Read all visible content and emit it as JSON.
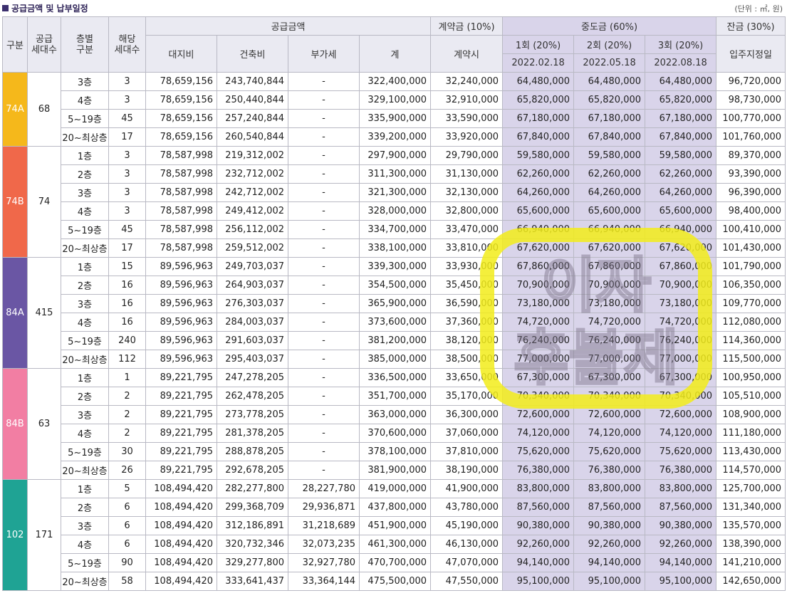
{
  "title": "공급금액 및 납부일정",
  "unit": "(단위 : ㎡, 원)",
  "header": {
    "col_type": "구분",
    "col_supply_units": "공급\n세대수",
    "col_floor": "층별\n구분",
    "col_units": "해당\n세대수",
    "supply_group": "공급금액",
    "land": "대지비",
    "building": "건축비",
    "vat": "부가세",
    "total": "계",
    "contract_group": "계약금 (10%)",
    "contract_sub": "계약시",
    "middle_group": "중도금 (60%)",
    "mid1": "1회 (20%)",
    "mid2": "2회 (20%)",
    "mid3": "3회 (20%)",
    "mid1_date": "2022.02.18",
    "mid2_date": "2022.05.18",
    "mid3_date": "2022.08.18",
    "balance_group": "잔금 (30%)",
    "balance_sub": "입주지정일"
  },
  "watermark": "이자\n후불제",
  "groups": [
    {
      "type": "74A",
      "color": "#f5b81b",
      "supply_units": "68",
      "rows": [
        {
          "floor": "3층",
          "units": "3",
          "land": "78,659,156",
          "building": "243,740,844",
          "vat": "-",
          "total": "322,400,000",
          "contract": "32,240,000",
          "m1": "64,480,000",
          "m2": "64,480,000",
          "m3": "64,480,000",
          "balance": "96,720,000"
        },
        {
          "floor": "4층",
          "units": "3",
          "land": "78,659,156",
          "building": "250,440,844",
          "vat": "-",
          "total": "329,100,000",
          "contract": "32,910,000",
          "m1": "65,820,000",
          "m2": "65,820,000",
          "m3": "65,820,000",
          "balance": "98,730,000"
        },
        {
          "floor": "5~19층",
          "units": "45",
          "land": "78,659,156",
          "building": "257,240,844",
          "vat": "-",
          "total": "335,900,000",
          "contract": "33,590,000",
          "m1": "67,180,000",
          "m2": "67,180,000",
          "m3": "67,180,000",
          "balance": "100,770,000"
        },
        {
          "floor": "20~최상층",
          "units": "17",
          "land": "78,659,156",
          "building": "260,540,844",
          "vat": "-",
          "total": "339,200,000",
          "contract": "33,920,000",
          "m1": "67,840,000",
          "m2": "67,840,000",
          "m3": "67,840,000",
          "balance": "101,760,000"
        }
      ]
    },
    {
      "type": "74B",
      "color": "#f0684a",
      "supply_units": "74",
      "rows": [
        {
          "floor": "1층",
          "units": "3",
          "land": "78,587,998",
          "building": "219,312,002",
          "vat": "-",
          "total": "297,900,000",
          "contract": "29,790,000",
          "m1": "59,580,000",
          "m2": "59,580,000",
          "m3": "59,580,000",
          "balance": "89,370,000"
        },
        {
          "floor": "2층",
          "units": "3",
          "land": "78,587,998",
          "building": "232,712,002",
          "vat": "-",
          "total": "311,300,000",
          "contract": "31,130,000",
          "m1": "62,260,000",
          "m2": "62,260,000",
          "m3": "62,260,000",
          "balance": "93,390,000"
        },
        {
          "floor": "3층",
          "units": "3",
          "land": "78,587,998",
          "building": "242,712,002",
          "vat": "-",
          "total": "321,300,000",
          "contract": "32,130,000",
          "m1": "64,260,000",
          "m2": "64,260,000",
          "m3": "64,260,000",
          "balance": "96,390,000"
        },
        {
          "floor": "4층",
          "units": "3",
          "land": "78,587,998",
          "building": "249,412,002",
          "vat": "-",
          "total": "328,000,000",
          "contract": "32,800,000",
          "m1": "65,600,000",
          "m2": "65,600,000",
          "m3": "65,600,000",
          "balance": "98,400,000"
        },
        {
          "floor": "5~19층",
          "units": "45",
          "land": "78,587,998",
          "building": "256,112,002",
          "vat": "-",
          "total": "334,700,000",
          "contract": "33,470,000",
          "m1": "66,940,000",
          "m2": "66,940,000",
          "m3": "66,940,000",
          "balance": "100,410,000"
        },
        {
          "floor": "20~최상층",
          "units": "17",
          "land": "78,587,998",
          "building": "259,512,002",
          "vat": "-",
          "total": "338,100,000",
          "contract": "33,810,000",
          "m1": "67,620,000",
          "m2": "67,620,000",
          "m3": "67,620,000",
          "balance": "101,430,000"
        }
      ]
    },
    {
      "type": "84A",
      "color": "#6a56a4",
      "supply_units": "415",
      "rows": [
        {
          "floor": "1층",
          "units": "15",
          "land": "89,596,963",
          "building": "249,703,037",
          "vat": "-",
          "total": "339,300,000",
          "contract": "33,930,000",
          "m1": "67,860,000",
          "m2": "67,860,000",
          "m3": "67,860,000",
          "balance": "101,790,000"
        },
        {
          "floor": "2층",
          "units": "16",
          "land": "89,596,963",
          "building": "264,903,037",
          "vat": "-",
          "total": "354,500,000",
          "contract": "35,450,000",
          "m1": "70,900,000",
          "m2": "70,900,000",
          "m3": "70,900,000",
          "balance": "106,350,000"
        },
        {
          "floor": "3층",
          "units": "16",
          "land": "89,596,963",
          "building": "276,303,037",
          "vat": "-",
          "total": "365,900,000",
          "contract": "36,590,000",
          "m1": "73,180,000",
          "m2": "73,180,000",
          "m3": "73,180,000",
          "balance": "109,770,000"
        },
        {
          "floor": "4층",
          "units": "16",
          "land": "89,596,963",
          "building": "284,003,037",
          "vat": "-",
          "total": "373,600,000",
          "contract": "37,360,000",
          "m1": "74,720,000",
          "m2": "74,720,000",
          "m3": "74,720,000",
          "balance": "112,080,000"
        },
        {
          "floor": "5~19층",
          "units": "240",
          "land": "89,596,963",
          "building": "291,603,037",
          "vat": "-",
          "total": "381,200,000",
          "contract": "38,120,000",
          "m1": "76,240,000",
          "m2": "76,240,000",
          "m3": "76,240,000",
          "balance": "114,360,000"
        },
        {
          "floor": "20~최상층",
          "units": "112",
          "land": "89,596,963",
          "building": "295,403,037",
          "vat": "-",
          "total": "385,000,000",
          "contract": "38,500,000",
          "m1": "77,000,000",
          "m2": "77,000,000",
          "m3": "77,000,000",
          "balance": "115,500,000"
        }
      ]
    },
    {
      "type": "84B",
      "color": "#f27ea3",
      "supply_units": "63",
      "rows": [
        {
          "floor": "1층",
          "units": "1",
          "land": "89,221,795",
          "building": "247,278,205",
          "vat": "-",
          "total": "336,500,000",
          "contract": "33,650,000",
          "m1": "67,300,000",
          "m2": "67,300,000",
          "m3": "67,300,000",
          "balance": "100,950,000"
        },
        {
          "floor": "2층",
          "units": "2",
          "land": "89,221,795",
          "building": "262,478,205",
          "vat": "-",
          "total": "351,700,000",
          "contract": "35,170,000",
          "m1": "70,340,000",
          "m2": "70,340,000",
          "m3": "70,340,000",
          "balance": "105,510,000"
        },
        {
          "floor": "3층",
          "units": "2",
          "land": "89,221,795",
          "building": "273,778,205",
          "vat": "-",
          "total": "363,000,000",
          "contract": "36,300,000",
          "m1": "72,600,000",
          "m2": "72,600,000",
          "m3": "72,600,000",
          "balance": "108,900,000"
        },
        {
          "floor": "4층",
          "units": "2",
          "land": "89,221,795",
          "building": "281,378,205",
          "vat": "-",
          "total": "370,600,000",
          "contract": "37,060,000",
          "m1": "74,120,000",
          "m2": "74,120,000",
          "m3": "74,120,000",
          "balance": "111,180,000"
        },
        {
          "floor": "5~19층",
          "units": "30",
          "land": "89,221,795",
          "building": "288,878,205",
          "vat": "-",
          "total": "378,100,000",
          "contract": "37,810,000",
          "m1": "75,620,000",
          "m2": "75,620,000",
          "m3": "75,620,000",
          "balance": "113,430,000"
        },
        {
          "floor": "20~최상층",
          "units": "26",
          "land": "89,221,795",
          "building": "292,678,205",
          "vat": "-",
          "total": "381,900,000",
          "contract": "38,190,000",
          "m1": "76,380,000",
          "m2": "76,380,000",
          "m3": "76,380,000",
          "balance": "114,570,000"
        }
      ]
    },
    {
      "type": "102",
      "color": "#1fa394",
      "supply_units": "171",
      "rows": [
        {
          "floor": "1층",
          "units": "5",
          "land": "108,494,420",
          "building": "282,277,800",
          "vat": "28,227,780",
          "total": "419,000,000",
          "contract": "41,900,000",
          "m1": "83,800,000",
          "m2": "83,800,000",
          "m3": "83,800,000",
          "balance": "125,700,000"
        },
        {
          "floor": "2층",
          "units": "6",
          "land": "108,494,420",
          "building": "299,368,709",
          "vat": "29,936,871",
          "total": "437,800,000",
          "contract": "43,780,000",
          "m1": "87,560,000",
          "m2": "87,560,000",
          "m3": "87,560,000",
          "balance": "131,340,000"
        },
        {
          "floor": "3층",
          "units": "6",
          "land": "108,494,420",
          "building": "312,186,891",
          "vat": "31,218,689",
          "total": "451,900,000",
          "contract": "45,190,000",
          "m1": "90,380,000",
          "m2": "90,380,000",
          "m3": "90,380,000",
          "balance": "135,570,000"
        },
        {
          "floor": "4층",
          "units": "6",
          "land": "108,494,420",
          "building": "320,732,346",
          "vat": "32,073,235",
          "total": "461,300,000",
          "contract": "46,130,000",
          "m1": "92,260,000",
          "m2": "92,260,000",
          "m3": "92,260,000",
          "balance": "138,390,000"
        },
        {
          "floor": "5~19층",
          "units": "90",
          "land": "108,494,420",
          "building": "329,277,800",
          "vat": "32,927,780",
          "total": "470,700,000",
          "contract": "47,070,000",
          "m1": "94,140,000",
          "m2": "94,140,000",
          "m3": "94,140,000",
          "balance": "141,210,000"
        },
        {
          "floor": "20~최상층",
          "units": "58",
          "land": "108,494,420",
          "building": "333,641,437",
          "vat": "33,364,144",
          "total": "475,500,000",
          "contract": "47,550,000",
          "m1": "95,100,000",
          "m2": "95,100,000",
          "m3": "95,100,000",
          "balance": "142,650,000"
        }
      ]
    }
  ]
}
